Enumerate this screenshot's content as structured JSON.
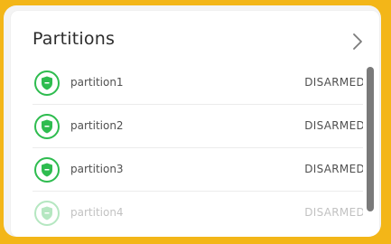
{
  "header": {
    "title": "Partitions"
  },
  "partitions": [
    {
      "name": "partition1",
      "status": "DISARMED"
    },
    {
      "name": "partition2",
      "status": "DISARMED"
    },
    {
      "name": "partition3",
      "status": "DISARMED"
    },
    {
      "name": "partition4",
      "status": "DISARMED"
    }
  ],
  "icons": {
    "chevron": "chevron-right-icon",
    "status": "shield-icon"
  },
  "colors": {
    "frame": "#f3b618",
    "shield": "#2ebc4f",
    "text": "#505050"
  }
}
